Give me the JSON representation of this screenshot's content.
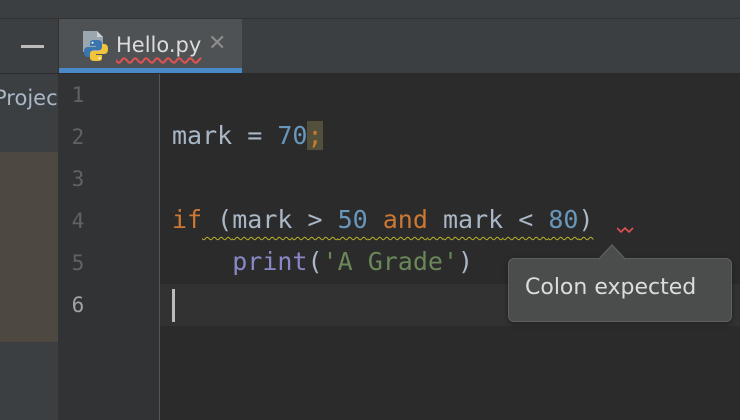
{
  "tab": {
    "filename": "Hello.py",
    "close_glyph": "✕",
    "icon": "python-file-icon"
  },
  "project_panel": {
    "label": "Project"
  },
  "gutter": {
    "line_numbers": [
      "1",
      "2",
      "3",
      "4",
      "5",
      "6"
    ],
    "current_line": "6"
  },
  "code": {
    "line2": {
      "ident": "mark",
      "eq": " = ",
      "num": "70",
      "semi": ";"
    },
    "line4": {
      "kw_if": "if",
      "open": " (",
      "id1": "mark",
      "gt": " > ",
      "n50": "50",
      "kw_and": " and",
      "sp": " ",
      "id2": "mark",
      "lt": " < ",
      "n80": "80",
      "close": ")"
    },
    "line5": {
      "indent": "    ",
      "fn": "print",
      "lp": "(",
      "str": "'A Grade'",
      "rp": ")"
    }
  },
  "tooltip": {
    "message": "Colon expected"
  },
  "colors": {
    "background": "#2b2b2b",
    "keyword": "#cc7832",
    "number": "#6897bb",
    "string": "#6a8759",
    "builtin": "#8888c6",
    "tab_accent": "#4a88c7",
    "error": "#e05252"
  }
}
